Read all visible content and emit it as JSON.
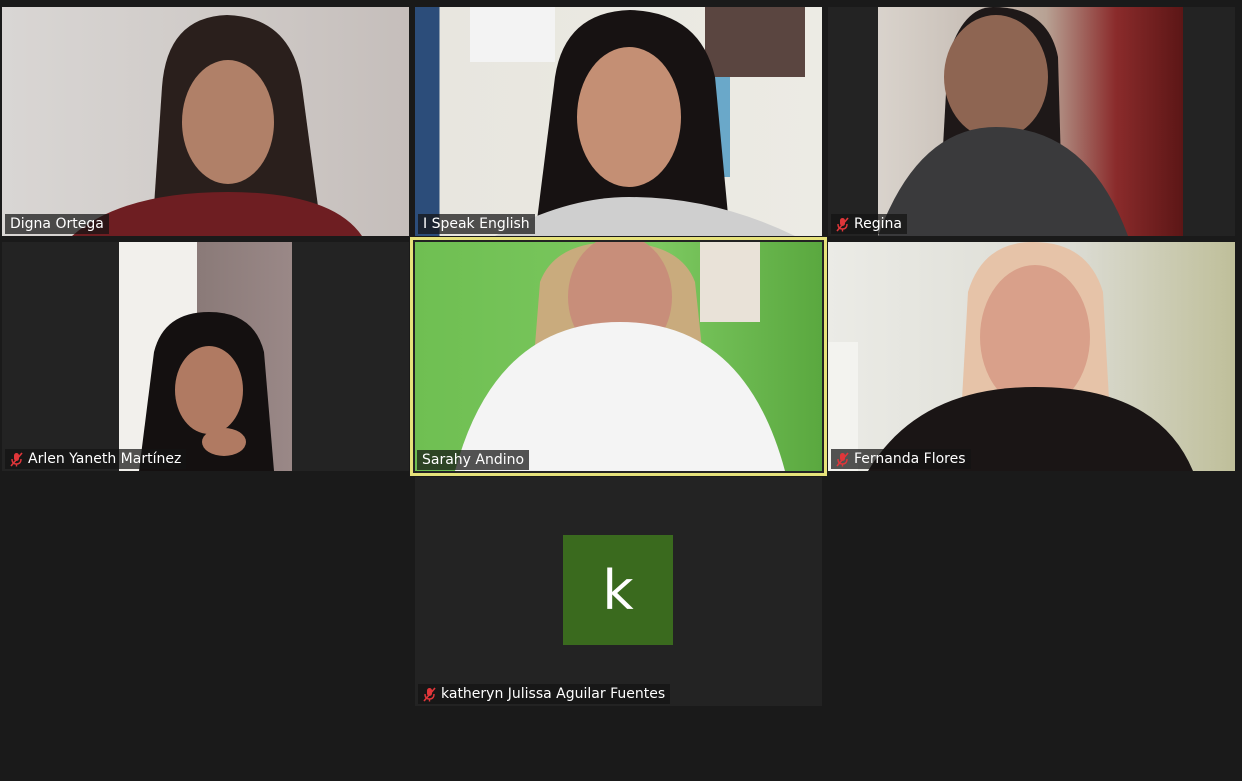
{
  "meeting": {
    "participants": [
      {
        "name": "Digna Ortega",
        "muted": false
      },
      {
        "name": "I Speak English",
        "muted": false
      },
      {
        "name": "Regina",
        "muted": true
      },
      {
        "name": "Arlen Yaneth Martínez",
        "muted": true
      },
      {
        "name": "Sarahy Andino",
        "muted": false,
        "active_speaker": true
      },
      {
        "name": "Fernanda Flores",
        "muted": true
      },
      {
        "name": "katheryn Julissa Aguilar Fuentes",
        "muted": true,
        "video_off": true,
        "avatar_letter": "k"
      }
    ]
  },
  "icons": {
    "mute": "mic-muted-icon"
  },
  "colors": {
    "active_speaker_border": "#e6e27a",
    "avatar_bg": "#3a6a1e",
    "muted_icon": "#e0363a"
  }
}
